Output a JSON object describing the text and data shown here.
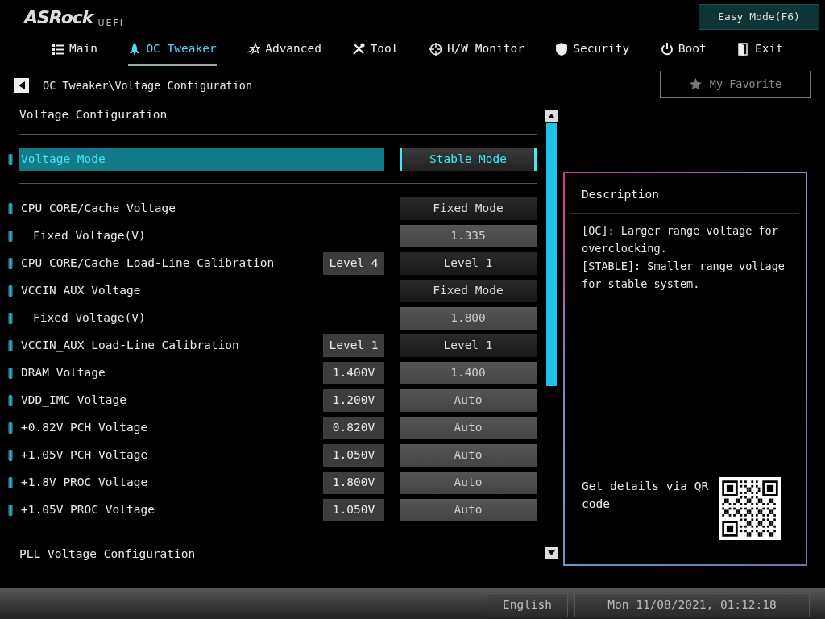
{
  "header": {
    "logo": "ASRock",
    "logo_suffix": "UEFI",
    "easy_mode_button": "Easy Mode(F6)"
  },
  "tabs": [
    {
      "label": "Main",
      "selected": false
    },
    {
      "label": "OC Tweaker",
      "selected": true
    },
    {
      "label": "Advanced",
      "selected": false
    },
    {
      "label": "Tool",
      "selected": false
    },
    {
      "label": "H/W Monitor",
      "selected": false
    },
    {
      "label": "Security",
      "selected": false
    },
    {
      "label": "Boot",
      "selected": false
    },
    {
      "label": "Exit",
      "selected": false
    }
  ],
  "breadcrumb": "OC Tweaker\\Voltage Configuration",
  "favorite_button": "My Favorite",
  "section_title": "Voltage Configuration",
  "groups": [
    {
      "settings": [
        {
          "label": "Voltage Mode",
          "control": "Stable Mode",
          "kind": "select",
          "selected": true
        }
      ]
    },
    {
      "settings": [
        {
          "label": "CPU CORE/Cache Voltage",
          "control": "Fixed Mode",
          "kind": "select",
          "selected": false,
          "children": [
            {
              "label": "Fixed Voltage(V)",
              "control": "1.335",
              "kind": "input",
              "selected": false
            }
          ]
        },
        {
          "label": "CPU CORE/Cache Load-Line Calibration",
          "current": "Level 4",
          "control": "Level 1",
          "kind": "select",
          "selected": false
        },
        {
          "label": "VCCIN_AUX Voltage",
          "control": "Fixed Mode",
          "kind": "select",
          "selected": false,
          "children": [
            {
              "label": "Fixed Voltage(V)",
              "control": "1.800",
              "kind": "input",
              "selected": false
            }
          ]
        },
        {
          "label": "VCCIN_AUX Load-Line Calibration",
          "current": "Level 1",
          "control": "Level 1",
          "kind": "select",
          "selected": false
        },
        {
          "label": "DRAM Voltage",
          "current": "1.400V",
          "control": "1.400",
          "kind": "input",
          "selected": false
        },
        {
          "label": "VDD_IMC Voltage",
          "current": "1.200V",
          "control": "Auto",
          "kind": "input",
          "selected": false
        },
        {
          "label": "+0.82V PCH Voltage",
          "current": "0.820V",
          "control": "Auto",
          "kind": "input",
          "selected": false
        },
        {
          "label": "+1.05V PCH Voltage",
          "current": "1.050V",
          "control": "Auto",
          "kind": "input",
          "selected": false
        },
        {
          "label": "+1.8V PROC Voltage",
          "current": "1.800V",
          "control": "Auto",
          "kind": "input",
          "selected": false
        },
        {
          "label": "+1.05V PROC Voltage",
          "current": "1.050V",
          "control": "Auto",
          "kind": "input",
          "selected": false
        }
      ]
    }
  ],
  "submenu": "PLL Voltage Configuration",
  "description": {
    "title": "Description",
    "lines": [
      "[OC]: Larger range voltage for overclocking.",
      "[STABLE]: Smaller range voltage for stable system."
    ],
    "qr_text": "Get details via QR code"
  },
  "status_bar": {
    "language": "English",
    "datetime": "Mon 11/08/2021, 01:12:18"
  }
}
